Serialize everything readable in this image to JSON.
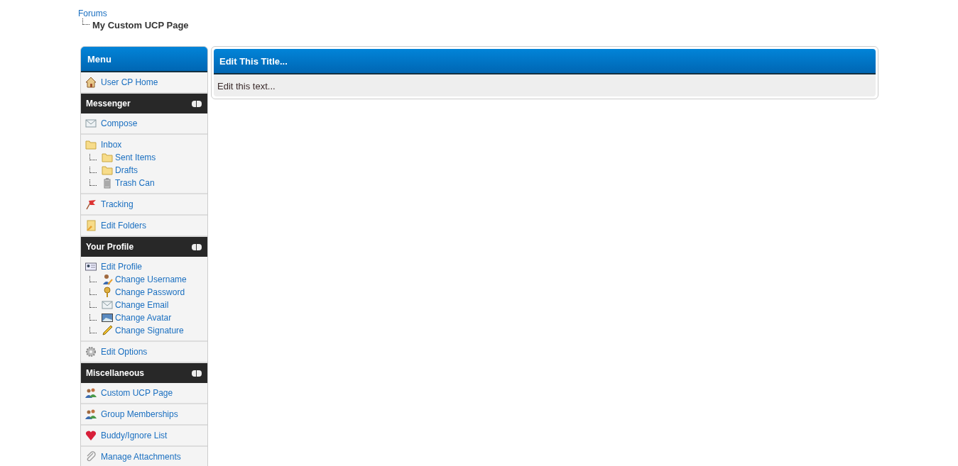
{
  "breadcrumb": {
    "parent": "Forums",
    "current": "My Custom UCP Page"
  },
  "sidebar": {
    "sections": [
      {
        "kind": "main",
        "title": "Menu",
        "groups": [
          {
            "label": "User CP Home"
          }
        ]
      },
      {
        "kind": "category",
        "title": "Messenger",
        "expanded": true,
        "groups": [
          {
            "label": "Compose"
          },
          {
            "label": "Inbox",
            "children": [
              {
                "label": "Sent Items"
              },
              {
                "label": "Drafts"
              },
              {
                "label": "Trash Can"
              }
            ]
          },
          {
            "label": "Tracking"
          },
          {
            "label": "Edit Folders"
          }
        ]
      },
      {
        "kind": "category",
        "title": "Your Profile",
        "expanded": true,
        "groups": [
          {
            "label": "Edit Profile",
            "children": [
              {
                "label": "Change Username"
              },
              {
                "label": "Change Password"
              },
              {
                "label": "Change Email"
              },
              {
                "label": "Change Avatar"
              },
              {
                "label": "Change Signature"
              }
            ]
          },
          {
            "label": "Edit Options"
          }
        ]
      },
      {
        "kind": "category",
        "title": "Miscellaneous",
        "expanded": true,
        "groups": [
          {
            "label": "Custom UCP Page"
          },
          {
            "label": "Group Memberships"
          },
          {
            "label": "Buddy/Ignore List"
          },
          {
            "label": "Manage Attachments"
          }
        ]
      }
    ]
  },
  "panel": {
    "title": "Edit This Title...",
    "text": "Edit this text..."
  }
}
